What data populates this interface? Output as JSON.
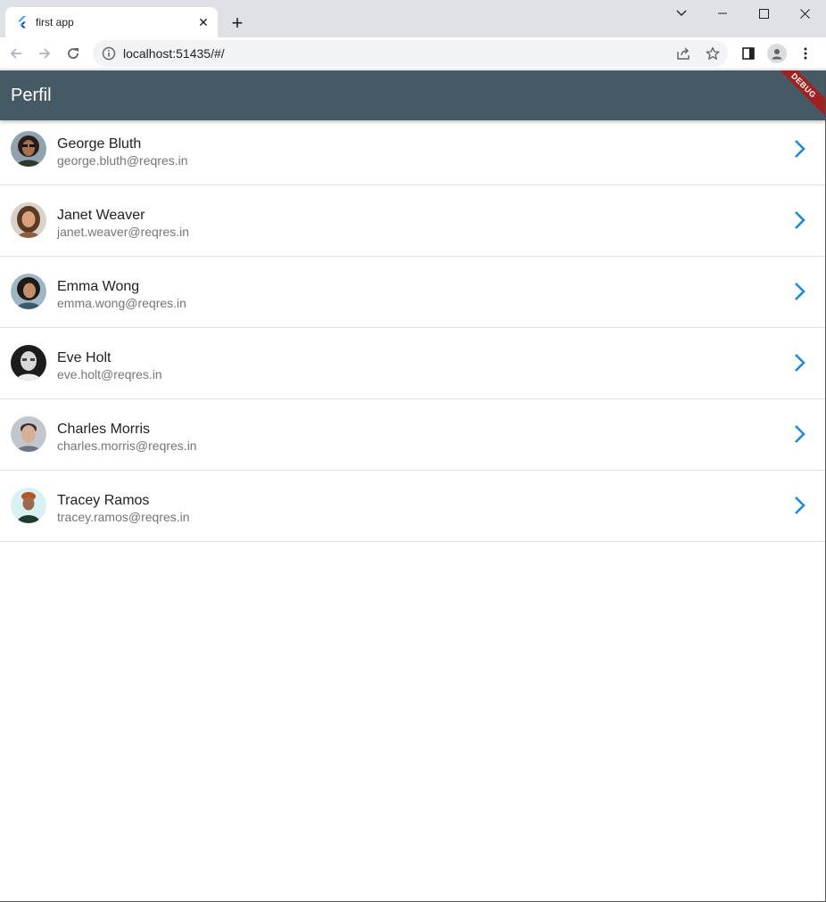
{
  "browser": {
    "tab": {
      "title": "first app",
      "close_glyph": "✕"
    },
    "new_tab_glyph": "+",
    "address": {
      "url": "localhost:51435/#/"
    }
  },
  "app": {
    "title": "Perfil",
    "debug_label": "DEBUG",
    "colors": {
      "appbar": "#455a64",
      "chevron": "#1e88e5",
      "banner": "#a32020"
    }
  },
  "users": [
    {
      "name": "George Bluth",
      "email": "george.bluth@reqres.in"
    },
    {
      "name": "Janet Weaver",
      "email": "janet.weaver@reqres.in"
    },
    {
      "name": "Emma Wong",
      "email": "emma.wong@reqres.in"
    },
    {
      "name": "Eve Holt",
      "email": "eve.holt@reqres.in"
    },
    {
      "name": "Charles Morris",
      "email": "charles.morris@reqres.in"
    },
    {
      "name": "Tracey Ramos",
      "email": "tracey.ramos@reqres.in"
    }
  ]
}
